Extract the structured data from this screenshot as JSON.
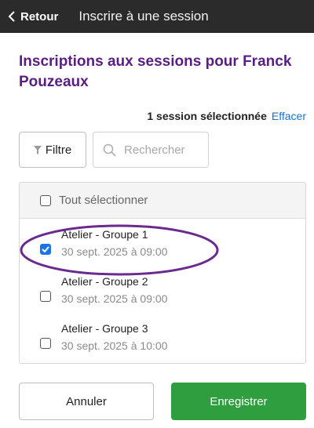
{
  "header": {
    "back_label": "Retour",
    "title": "Inscrire à une session",
    "background": "#2b2b2b"
  },
  "page_title": "Inscriptions aux sessions pour Franck Pouzeaux",
  "selection": {
    "count_text": "1 session sélectionnée",
    "clear_label": "Effacer"
  },
  "toolbar": {
    "filter_label": "Filtre",
    "search_placeholder": "Rechercher",
    "search_value": ""
  },
  "list": {
    "select_all_label": "Tout sélectionner",
    "select_all_checked": false,
    "sessions": [
      {
        "name": "Atelier - Groupe 1",
        "date": "30 sept. 2025 à 09:00",
        "checked": true
      },
      {
        "name": "Atelier - Groupe 2",
        "date": "30 sept. 2025 à 09:00",
        "checked": false
      },
      {
        "name": "Atelier - Groupe 3",
        "date": "30 sept. 2025 à 10:00",
        "checked": false
      }
    ]
  },
  "footer": {
    "cancel_label": "Annuler",
    "save_label": "Enregistrer"
  },
  "colors": {
    "title_purple": "#5a1e82",
    "link_blue": "#1a73c8",
    "checkbox_blue": "#1a73e8",
    "save_green": "#2e9e3f",
    "highlight_purple": "#6a2a8e"
  },
  "icons": [
    "chevron-left-icon",
    "filter-icon",
    "search-icon",
    "checkmark-icon"
  ]
}
